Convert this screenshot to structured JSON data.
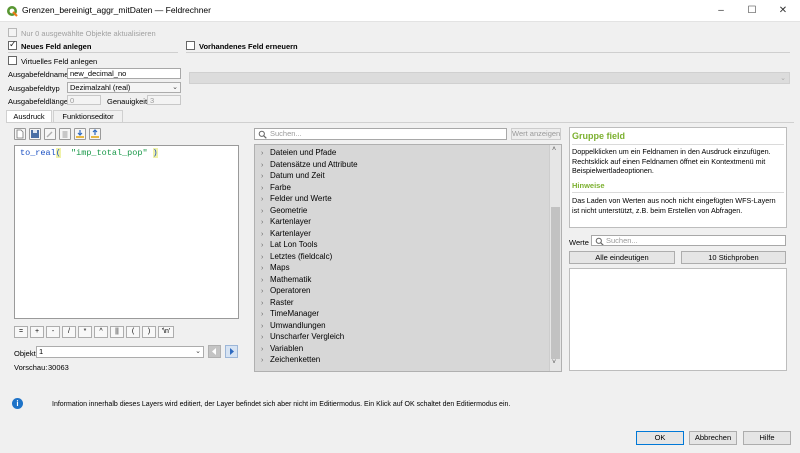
{
  "window": {
    "title": "Grenzen_bereinigt_aggr_mitDaten — Feldrechner",
    "minimize": "–",
    "maximize": "☐",
    "close": "✕"
  },
  "options": {
    "only_selected": "Nur 0 ausgewählte Objekte aktualisieren",
    "new_field": "Neues Feld anlegen",
    "update_field": "Vorhandenes Feld erneuern",
    "virtual_field": "Virtuelles Feld anlegen"
  },
  "form": {
    "output_name_label": "Ausgabefeldname",
    "output_name_value": "new_decimal_no",
    "output_type_label": "Ausgabefeldtyp",
    "output_type_value": "Dezimalzahl (real)",
    "output_length_label": "Ausgabefeldlänge",
    "output_length_value": "0",
    "precision_label": "Genauigkeit",
    "precision_value": "3"
  },
  "tabs": [
    "Ausdruck",
    "Funktionseditor"
  ],
  "expression": {
    "func": "to_real",
    "open": "(",
    "field": "\"imp_total_pop\"",
    "close": ")"
  },
  "operators": [
    "=",
    "+",
    "-",
    "/",
    "*",
    "^",
    "||",
    "(",
    ")",
    "'\\n'"
  ],
  "feature": {
    "label": "Objekt",
    "value": "1"
  },
  "preview": {
    "label": "Vorschau:",
    "value": "30063"
  },
  "search": {
    "placeholder": "Suchen...",
    "show_values": "Wert anzeigen"
  },
  "function_groups": [
    "Dateien und Pfade",
    "Datensätze und Attribute",
    "Datum und Zeit",
    "Farbe",
    "Felder und Werte",
    "Geometrie",
    "Kartenlayer",
    "Kartenlayer",
    "Lat Lon Tools",
    "Letztes (fieldcalc)",
    "Maps",
    "Mathematik",
    "Operatoren",
    "Raster",
    "TimeManager",
    "Umwandlungen",
    "Unscharfer Vergleich",
    "Variablen",
    "Zeichenketten"
  ],
  "help": {
    "title": "Gruppe field",
    "text": "Doppelklicken um ein Feldnamen in den Ausdruck einzufügen. Rechtsklick auf einen Feldnamen öffnet ein Kontextmenü mit Beispielwertladeoptionen.",
    "notes_title": "Hinweise",
    "notes_text": "Das Laden von Werten aus noch nicht eingefügten WFS-Layern ist nicht unterstützt, z.B. beim Erstellen von Abfragen."
  },
  "values": {
    "label": "Werte",
    "placeholder": "Suchen...",
    "all_unique": "Alle eindeutigen",
    "samples": "10 Stichproben"
  },
  "info": {
    "text": "Information innerhalb dieses Layers wird editiert, der Layer befindet sich aber nicht im Editiermodus. Ein Klick auf OK schaltet den Editiermodus ein."
  },
  "buttons": {
    "ok": "OK",
    "cancel": "Abbrechen",
    "help": "Hilfe"
  },
  "colors": {
    "accent": "#7cb02f",
    "link_blue": "#1a4fc2",
    "string_green": "#189848",
    "info_blue": "#1e73c8"
  }
}
